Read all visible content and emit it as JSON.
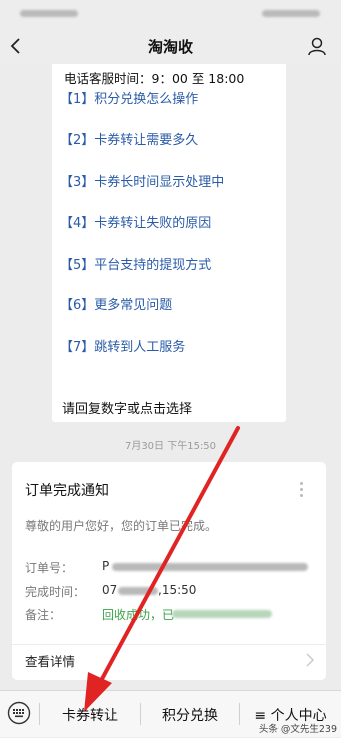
{
  "header": {
    "title": "淘淘收"
  },
  "menu": {
    "header": "电话客服时间：9：00 至 18:00",
    "items": [
      "【1】积分兑换怎么操作",
      "【2】卡券转让需要多久",
      "【3】卡券长时间显示处理中",
      "【4】卡券转让失败的原因",
      "【5】平台支持的提现方式",
      "【6】更多常见问题",
      "【7】跳转到人工服务"
    ],
    "footer": "请回复数字或点击选择"
  },
  "timestamp": "7月30日 下午15:50",
  "notice": {
    "title": "订单完成通知",
    "greeting": "尊敬的用户您好，您的订单已完成。",
    "order_label": "订单号：",
    "order_value": "P",
    "time_label": "完成时间：",
    "time_value": "07",
    "time_tail": ",15:50",
    "note_label": "备注：",
    "note_value": "回收成功，已",
    "details": "查看详情"
  },
  "bottom_menu": [
    "卡券转让",
    "积分兑换",
    "≡ 个人中心"
  ],
  "watermark": "头条 @文先生239",
  "colors": {
    "link": "#2a5ba8",
    "arrow": "#e02424",
    "success": "#3aa34a"
  }
}
